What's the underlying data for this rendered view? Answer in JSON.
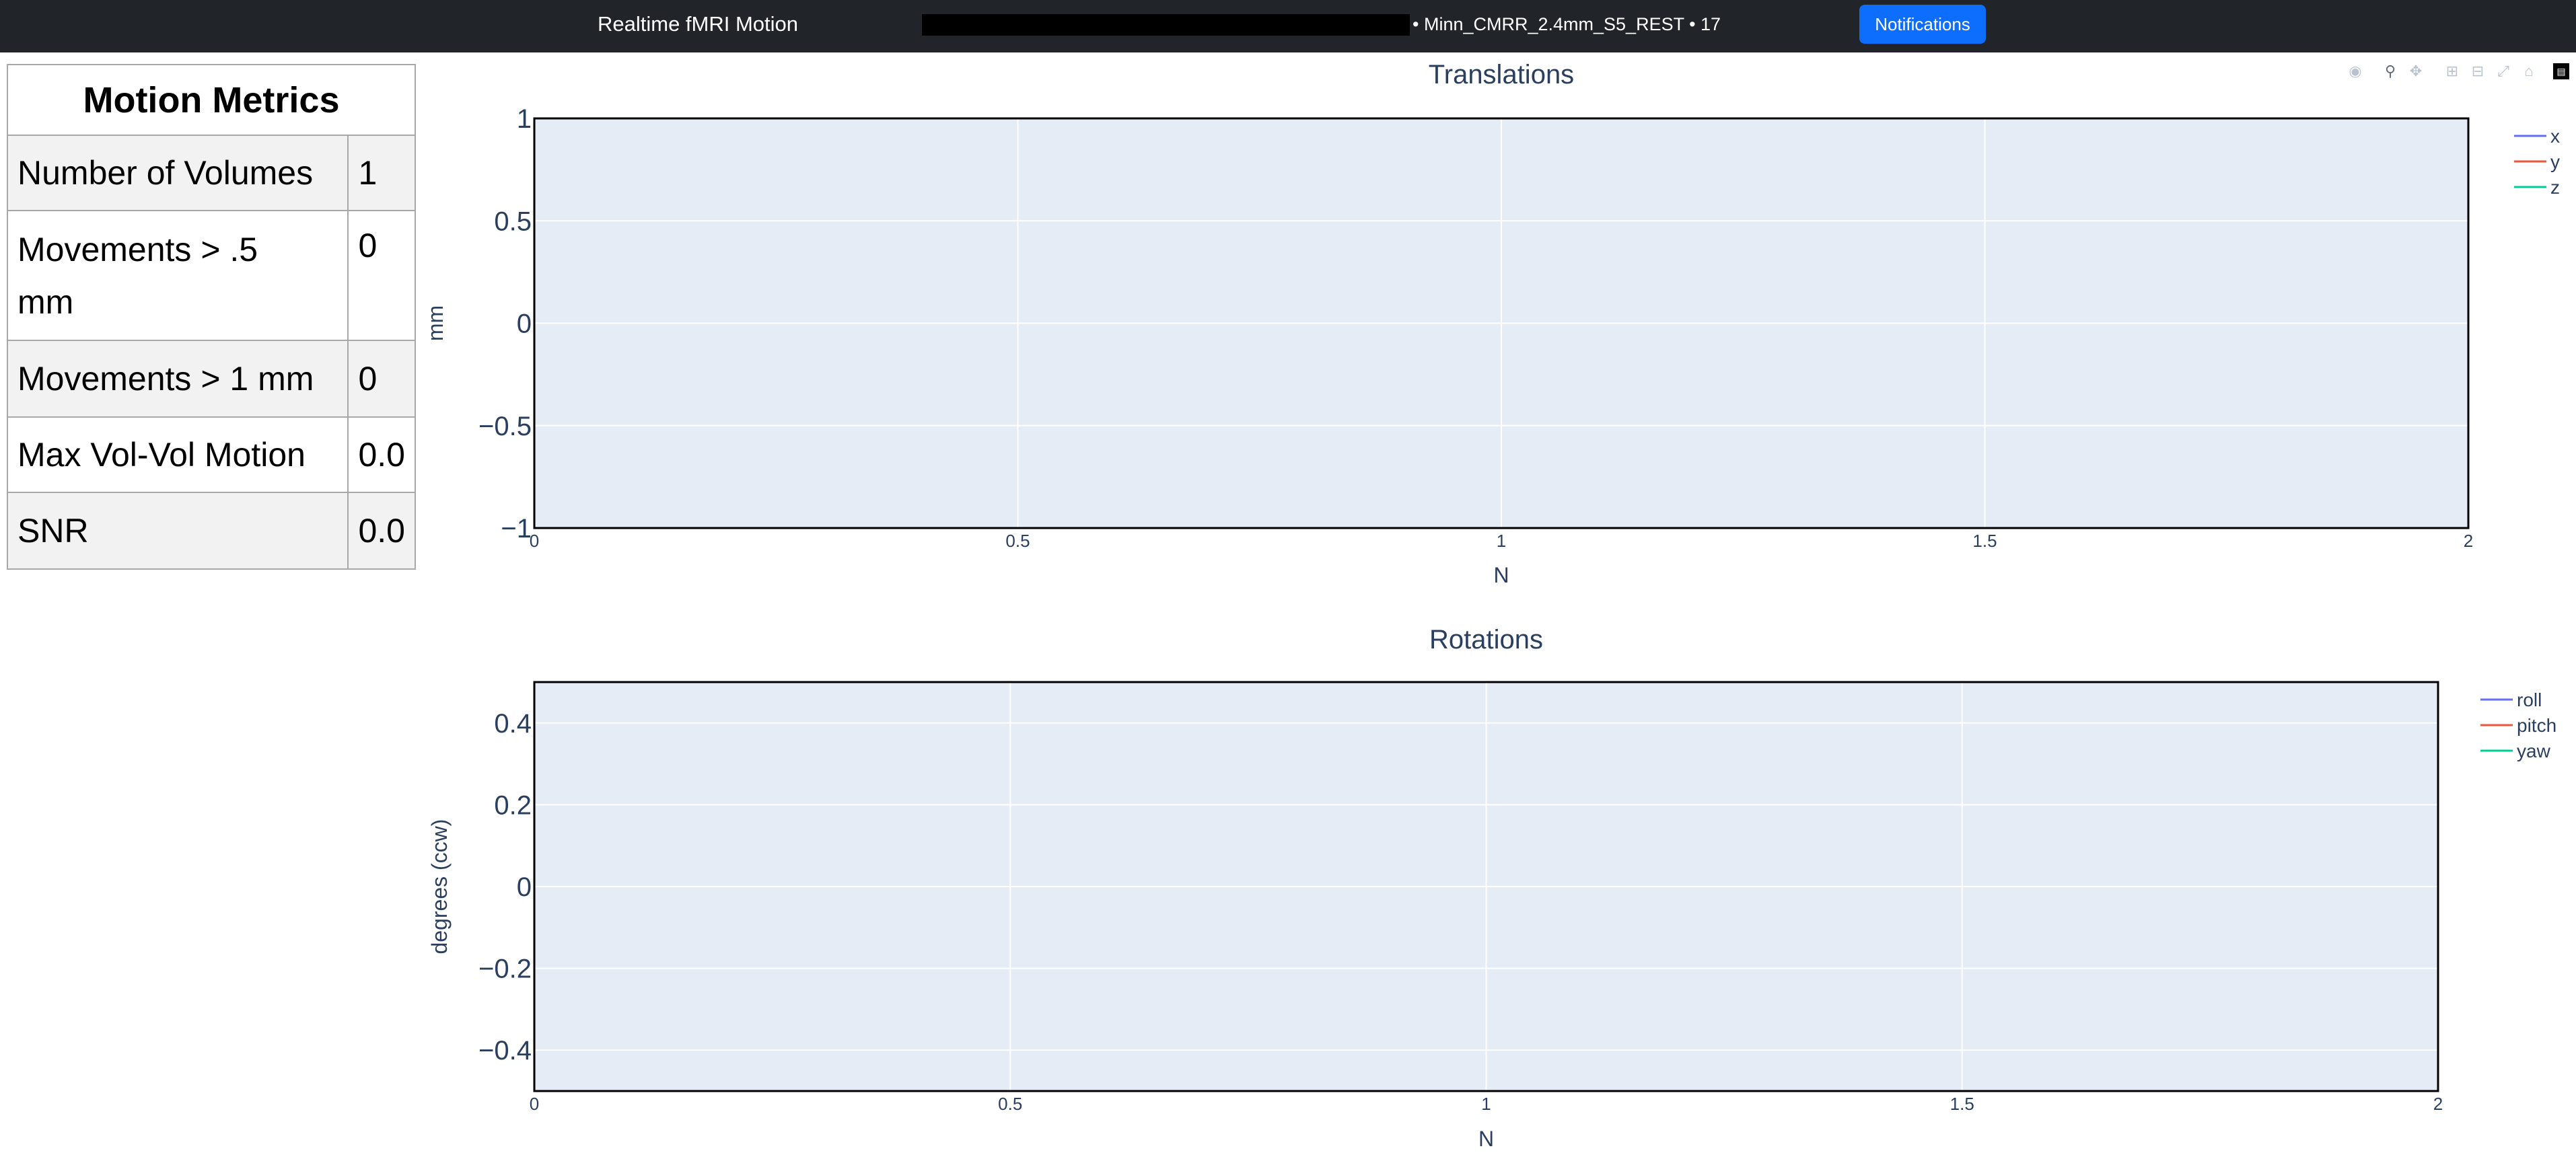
{
  "header": {
    "app_title": "Realtime fMRI Motion",
    "session_info": "• Minn_CMRR_2.4mm_S5_REST • 17",
    "notifications_label": "Notifications"
  },
  "metrics": {
    "title": "Motion Metrics",
    "rows": [
      {
        "label": "Number of Volumes",
        "value": "1"
      },
      {
        "label": "Movements > .5 mm",
        "value": "0"
      },
      {
        "label": "Movements > 1 mm",
        "value": "0"
      },
      {
        "label": "Max Vol-Vol Motion",
        "value": "0.0"
      },
      {
        "label": "SNR",
        "value": "0.0"
      }
    ]
  },
  "modebar": {
    "icons": [
      "camera-icon",
      "zoom-icon",
      "pan-icon",
      "zoom-in-icon",
      "zoom-out-icon",
      "autoscale-icon",
      "reset-axes-icon",
      "plotly-logo-icon"
    ]
  },
  "colors": {
    "topbar": "#212529",
    "button": "#0d6efd",
    "plot_bg": "#e5ecf6",
    "series": [
      "#636efa",
      "#ef553b",
      "#00cc96"
    ]
  },
  "chart_data": [
    {
      "type": "line",
      "title": "Translations",
      "xlabel": "N",
      "ylabel": "mm",
      "xlim": [
        0,
        2
      ],
      "ylim": [
        -1,
        1
      ],
      "x_ticks": [
        "0",
        "0.5",
        "1",
        "1.5",
        "2"
      ],
      "y_ticks": [
        "1",
        "0.5",
        "0",
        "−0.5",
        "−1"
      ],
      "grid": true,
      "legend_position": "top-right",
      "series": [
        {
          "name": "x",
          "values": []
        },
        {
          "name": "y",
          "values": []
        },
        {
          "name": "z",
          "values": []
        }
      ]
    },
    {
      "type": "line",
      "title": "Rotations",
      "xlabel": "N",
      "ylabel": "degrees (ccw)",
      "xlim": [
        0,
        2
      ],
      "ylim": [
        -0.5,
        0.5
      ],
      "x_ticks": [
        "0",
        "0.5",
        "1",
        "1.5",
        "2"
      ],
      "y_ticks": [
        "0.4",
        "0.2",
        "0",
        "−0.2",
        "−0.4"
      ],
      "grid": true,
      "legend_position": "top-right",
      "series": [
        {
          "name": "roll",
          "values": []
        },
        {
          "name": "pitch",
          "values": []
        },
        {
          "name": "yaw",
          "values": []
        }
      ]
    }
  ]
}
